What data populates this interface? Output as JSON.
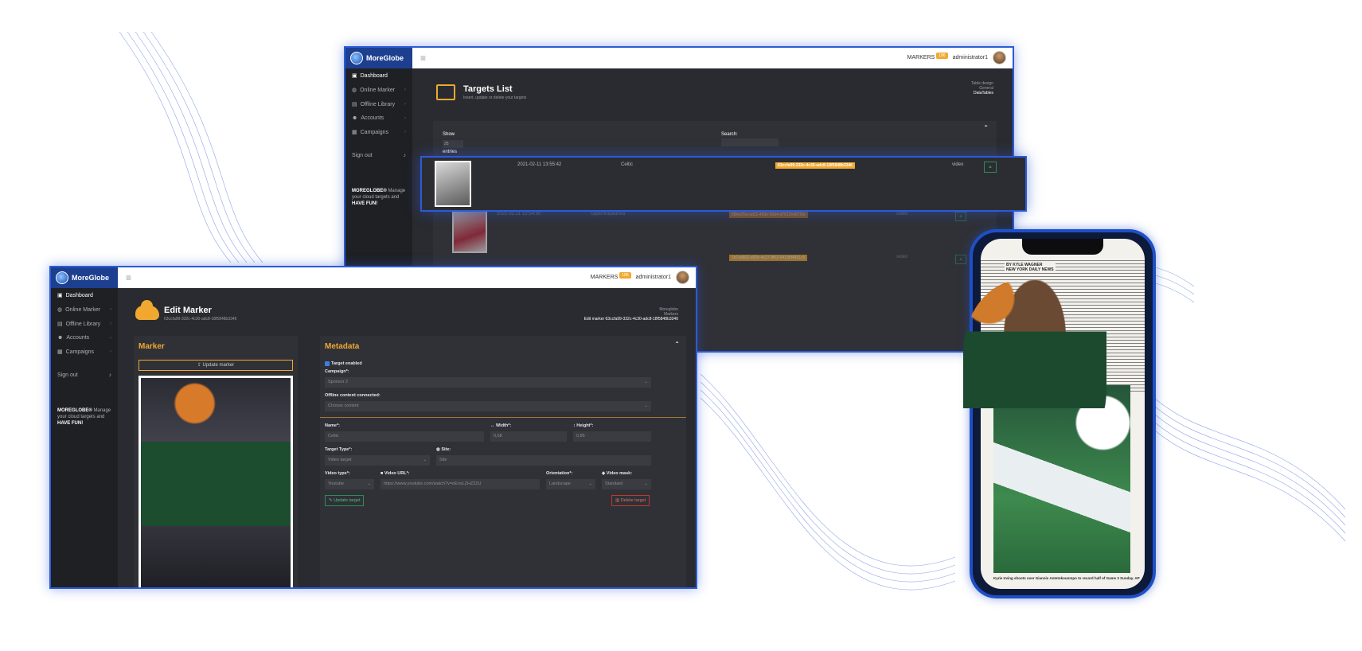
{
  "brand": {
    "name": "MoreGlobe"
  },
  "topbar": {
    "markers_label": "MARKERS",
    "markers_badge": "186",
    "username": "administrator1"
  },
  "sidebar": {
    "items": [
      {
        "label": "Dashboard",
        "icon": "dashboard-icon"
      },
      {
        "label": "Online Marker",
        "icon": "globe-icon"
      },
      {
        "label": "Offline Library",
        "icon": "book-icon"
      },
      {
        "label": "Accounts",
        "icon": "users-icon"
      },
      {
        "label": "Campaigns",
        "icon": "calendar-icon"
      }
    ],
    "signout": "Sign out",
    "note_brand": "MOREGLOBE®",
    "note_text": "Manage your cloud targets and",
    "note_fun": "HAVE FUN!"
  },
  "targets": {
    "title": "Targets List",
    "subtitle": "Insert, update or delete your targets",
    "crumbs": [
      "Table design",
      "General",
      "DataTables"
    ],
    "show_label": "Show",
    "show_value": "25",
    "entries_label": "entries",
    "search_label": "Search:",
    "rows": [
      {
        "date": "2021-02-11 13:55:42",
        "campaign": "Celtic",
        "id": "63ccfa99-332c-4c30-adc8-18f5848b3346",
        "type": "video"
      },
      {
        "date": "2021-02-11 13:54:30",
        "campaign": "capentrapadova",
        "id": "5f8ed7ba-ad11-460e-95d4-d76136487f9b",
        "type": "video"
      },
      {
        "date": "",
        "campaign": "",
        "id": "1b7a4802-d92b-4c27-9f03-0413f94951c5",
        "type": "video"
      }
    ]
  },
  "edit": {
    "title": "Edit Marker",
    "subtitle": "63ccfa99-332c-4c30-adc8-18f5848b3346",
    "crumbs": [
      "Moreglobe",
      "Markers"
    ],
    "crumb_current": "Edit marker 63ccfa99-332c-4c30-adc8-18f5848b3346",
    "marker_panel_title": "Marker",
    "update_marker": "Update marker",
    "metadata_title": "Metadata",
    "target_enabled": "Target enabled",
    "campaign_label": "Campaign*:",
    "campaign_value": "Sponsor 2",
    "offline_label": "Offline content connected:",
    "offline_value": "Choose content",
    "name_label": "Name*:",
    "name_value": "Celtic",
    "width_label": "Width*:",
    "width_value": "0,68",
    "height_label": "Height*:",
    "height_value": "0,86",
    "target_type_label": "Target Type*:",
    "target_type_value": "Video target",
    "site_label": "Site:",
    "site_placeholder": "Site",
    "video_type_label": "Video type*:",
    "video_type_value": "Youtube",
    "video_url_label": "Video URL*:",
    "video_url_value": "https://www.youtube.com/watch?v=oEnsLZHZ22U",
    "orientation_label": "Orientation*:",
    "orientation_value": "Landscape",
    "video_mask_label": "Video mask:",
    "video_mask_value": "Standard",
    "update_target": "Update target",
    "delete_target": "Delete target"
  },
  "phone": {
    "byline": "BY KYLE WAGNER",
    "byline_sub": "NEW YORK DAILY NEWS",
    "caption": "Kyrie Irving shoots over Giannis Antetokounmpo to record half of Game 3 Sunday. AP"
  },
  "colors": {
    "accent": "#f0a830",
    "frame_blue": "#2d5bd7",
    "panel_bg": "#303137",
    "green": "#2e8b57",
    "red": "#c0392b"
  }
}
